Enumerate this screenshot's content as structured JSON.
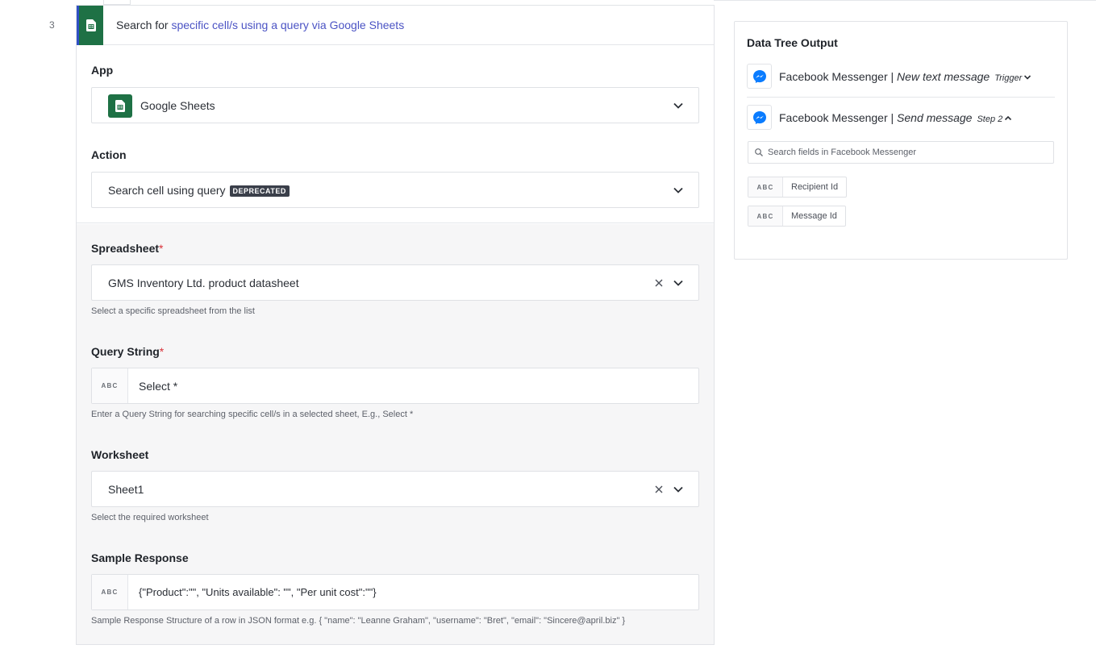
{
  "step": {
    "number": "3"
  },
  "header": {
    "prefix": "Search for ",
    "highlight": "specific cell/s using a query via Google Sheets"
  },
  "app": {
    "label": "App",
    "value": "Google Sheets"
  },
  "action": {
    "label": "Action",
    "value": "Search cell using query",
    "badge": "DEPRECATED"
  },
  "spreadsheet": {
    "label": "Spreadsheet",
    "required_mark": "*",
    "value": "GMS Inventory Ltd. product datasheet",
    "help": "Select a specific spreadsheet from the list"
  },
  "query_string": {
    "label": "Query String",
    "required_mark": "*",
    "type_tag": "ABC",
    "value": "Select *",
    "help": "Enter a Query String for searching specific cell/s in a selected sheet, E.g., Select *"
  },
  "worksheet": {
    "label": "Worksheet",
    "value": "Sheet1",
    "help": "Select the required worksheet"
  },
  "sample_response": {
    "label": "Sample Response",
    "type_tag": "ABC",
    "value": "{\"Product\":\"\", \"Units available\": \"\", \"Per unit cost\":\"\"}",
    "help": "Sample Response Structure of a row in JSON format e.g. { \"name\": \"Leanne Graham\", \"username\": \"Bret\", \"email\": \"Sincere@april.biz\" }"
  },
  "data_tree": {
    "title": "Data Tree Output",
    "items": [
      {
        "app": "Facebook Messenger | ",
        "event": "New text message",
        "tag": "Trigger",
        "icon": "messenger-icon",
        "expanded": false
      },
      {
        "app": "Facebook Messenger | ",
        "event": "Send message",
        "tag": "Step 2",
        "icon": "messenger-icon",
        "expanded": true
      }
    ],
    "search_placeholder": "Search fields in Facebook Messenger",
    "fields": [
      {
        "type_tag": "ABC",
        "label": "Recipient Id"
      },
      {
        "type_tag": "ABC",
        "label": "Message Id"
      }
    ]
  },
  "colors": {
    "sheets_green": "#1e7145",
    "highlight_blue": "#4b53c4",
    "required_red": "#d9323a",
    "messenger_blue": "#0a7cff"
  }
}
